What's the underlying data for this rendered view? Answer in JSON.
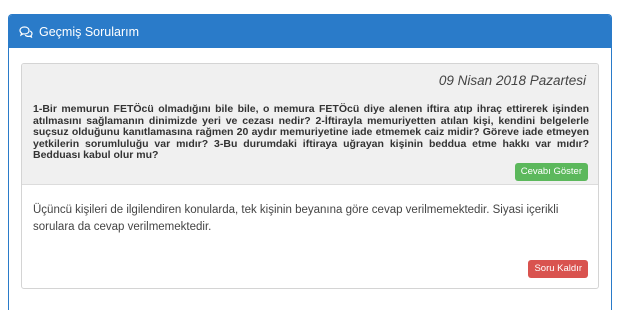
{
  "panel": {
    "title": "Geçmiş Sorularım",
    "icon": "comments-icon",
    "accent_color": "#2a7bc9"
  },
  "question": {
    "date": "09 Nisan 2018 Pazartesi",
    "text": "1-Bir memurun FETÖcü olmadığını bile bile, o memura FETÖcü diye alenen iftira atıp ihraç ettirerek işinden atılmasını sağlamanın dinimizde yeri ve cezası nedir? 2-İftirayla memuriyetten atılan kişi, kendini belgelerle suçsuz olduğunu kanıtlamasına rağmen 20 aydır memuriyetine iade etmemek caiz midir? Göreve iade etmeyen yetkilerin sorumluluğu var mıdır? 3-Bu durumdaki iftiraya uğrayan kişinin beddua etme hakkı var mıdır? Bedduası kabul olur mu?",
    "show_answer_label": "Cevabı Göster"
  },
  "answer": {
    "text": "Üçüncü kişileri de ilgilendiren konularda, tek kişinin beyanına göre cevap verilmemektedir. Siyasi içerikli sorulara da cevap verilmemektedir.",
    "remove_label": "Soru Kaldır"
  }
}
